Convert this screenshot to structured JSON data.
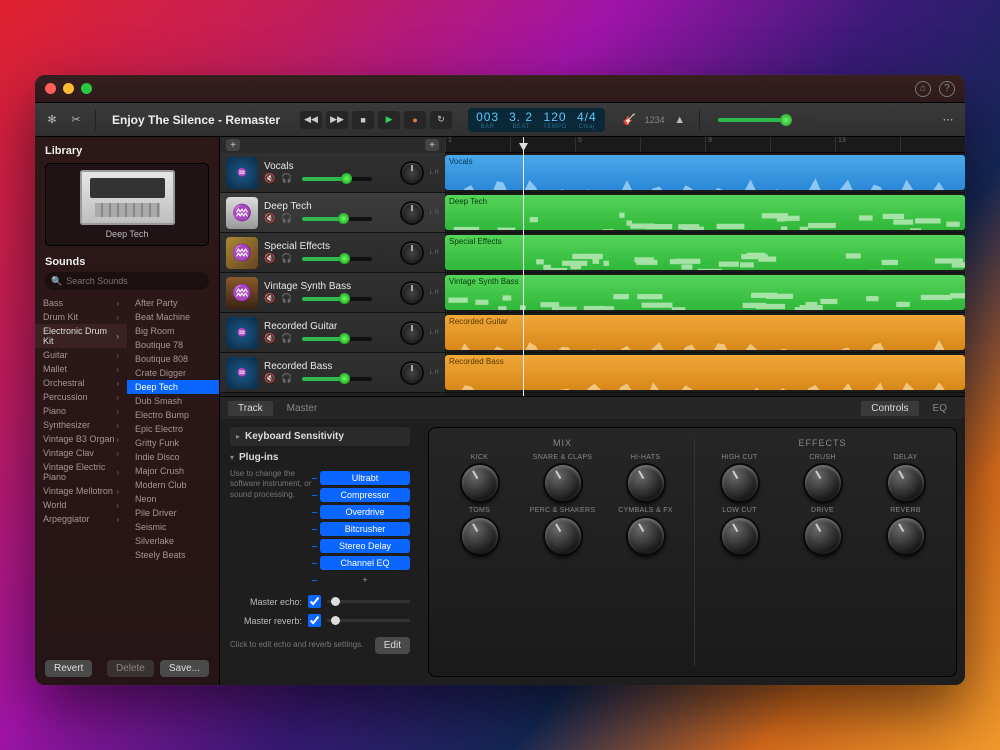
{
  "song_title": "Enjoy The Silence - Remaster",
  "transport": {
    "bar": "003",
    "beat": "3. 2",
    "tempo": "120",
    "timesig": "4/4",
    "key": "Cmaj",
    "count": "1234"
  },
  "master_volume_pct": 72,
  "library": {
    "title": "Library",
    "instrument_name": "Deep Tech",
    "sounds_title": "Sounds",
    "search_placeholder": "Search Sounds",
    "categories": [
      "Bass",
      "Drum Kit",
      "Electronic Drum Kit",
      "Guitar",
      "Mallet",
      "Orchestral",
      "Percussion",
      "Piano",
      "Synthesizer",
      "Vintage B3 Organ",
      "Vintage Clav",
      "Vintage Electric Piano",
      "Vintage Mellotron",
      "World",
      "Arpeggiator"
    ],
    "category_selected": 2,
    "presets": [
      "After Party",
      "Beat Machine",
      "Big Room",
      "Boutique 78",
      "Boutique 808",
      "Crate Digger",
      "Deep Tech",
      "Dub Smash",
      "Electro Bump",
      "Epic Electro",
      "Gritty Funk",
      "Indie Disco",
      "Major Crush",
      "Modern Club",
      "Neon",
      "Pile Driver",
      "Seismic",
      "Silverlake",
      "Steely Beats"
    ],
    "preset_selected": 6,
    "revert": "Revert",
    "delete": "Delete",
    "save": "Save..."
  },
  "tracks": [
    {
      "name": "Vocals",
      "type": "wave",
      "vol": 62,
      "color": "blue"
    },
    {
      "name": "Deep Tech",
      "type": "drum",
      "vol": 58,
      "color": "green"
    },
    {
      "name": "Special Effects",
      "type": "fx",
      "vol": 60,
      "color": "green"
    },
    {
      "name": "Vintage Synth Bass",
      "type": "synth",
      "vol": 60,
      "color": "green"
    },
    {
      "name": "Recorded Guitar",
      "type": "wave",
      "vol": 60,
      "color": "orange"
    },
    {
      "name": "Recorded Bass",
      "type": "wave",
      "vol": 60,
      "color": "orange"
    }
  ],
  "editor": {
    "tabs_left": [
      "Track",
      "Master"
    ],
    "tabs_right": [
      "Controls",
      "EQ"
    ],
    "tab_left_active": 0,
    "tab_right_active": 0,
    "keyboard_sens": "Keyboard Sensitivity",
    "plugins_title": "Plug-ins",
    "plugins_hint": "Use to change the software instrument, or sound processing.",
    "plugins": [
      "Ultrabt",
      "Compressor",
      "Overdrive",
      "Bitcrusher",
      "Stereo Delay",
      "Channel EQ"
    ],
    "master_echo_label": "Master echo:",
    "master_reverb_label": "Master reverb:",
    "echo_reverb_hint": "Click to edit echo and reverb settings.",
    "edit": "Edit",
    "mix_title": "MIX",
    "fx_title": "EFFECTS",
    "mix_knobs": [
      "KICK",
      "SNARE & CLAPS",
      "HI-HATS",
      "TOMS",
      "PERC & SHAKERS",
      "CYMBALS & FX"
    ],
    "fx_knobs": [
      "HIGH CUT",
      "CRUSH",
      "DELAY",
      "LOW CUT",
      "DRIVE",
      "REVERB"
    ]
  }
}
